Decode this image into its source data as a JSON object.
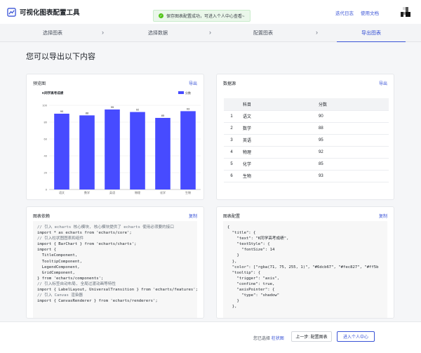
{
  "app": {
    "title": "可视化图表配置工具"
  },
  "toast": {
    "message": "保存图表配置成功，可进入个人中心查看~"
  },
  "header": {
    "changelog": "迭代日志",
    "docs": "使用文档"
  },
  "steps": [
    {
      "label": "选择图表"
    },
    {
      "label": "选择数据"
    },
    {
      "label": "配置图表"
    },
    {
      "label": "导出图表"
    }
  ],
  "page": {
    "title": "您可以导出以下内容"
  },
  "preview": {
    "title": "预览图",
    "action": "导出"
  },
  "datasource": {
    "title": "数据源",
    "action": "导出",
    "columns": [
      "",
      "科目",
      "分数"
    ],
    "rows": [
      [
        "1",
        "语文",
        "90"
      ],
      [
        "2",
        "数学",
        "88"
      ],
      [
        "3",
        "英语",
        "95"
      ],
      [
        "4",
        "物理",
        "92"
      ],
      [
        "5",
        "化学",
        "85"
      ],
      [
        "6",
        "生物",
        "93"
      ]
    ]
  },
  "deps": {
    "title": "图表依赖",
    "action": "复制",
    "lines": [
      "// 引入 echarts 核心模块, 核心模块提供了 echarts 使用必须要的接口",
      "import * as echarts from 'echarts/core';",
      "// 引入柱状图图表和组件",
      "import { BarChart } from 'echarts/charts';",
      "import {",
      "  TitleComponent,",
      "  TooltipComponent,",
      "  LegendComponent,",
      "  GridComponent,",
      "} from 'echarts/components';",
      "// 引入标签自动布局, 全局过渡动画等特性",
      "import { LabelLayout, UniversalTransition } from 'echarts/features';",
      "// 引入 Canvas 渲染器",
      "import { CanvasRenderer } from 'echarts/renderers';"
    ]
  },
  "config": {
    "title": "图表配置",
    "action": "复制",
    "lines": [
      "{",
      "  \"title\": {",
      "    \"text\": \"K同学高考成绩\",",
      "    \"textStyle\": {",
      "      \"fontSize\": 14",
      "    }",
      "  },",
      "  \"color\": [\"rgba(71, 75, 255, 1)\", \"#6dcb67\", \"#fec827\", \"#ff5b",
      "  \"tooltip\": {",
      "    \"trigger\": \"axis\",",
      "    \"confine\": true,",
      "    \"axisPointer\": {",
      "      \"type\": \"shadow\"",
      "    }",
      "  },"
    ]
  },
  "footer": {
    "prefix": "您已选择",
    "selected": "柱状图",
    "prev": "上一步: 配置图表",
    "next": "进入个人中心"
  },
  "chart_data": {
    "type": "bar",
    "title": "K同学高考成绩",
    "categories": [
      "语文",
      "数学",
      "英语",
      "物理",
      "化学",
      "生物"
    ],
    "series": [
      {
        "name": "分数",
        "values": [
          90,
          88,
          95,
          92,
          85,
          93
        ]
      }
    ],
    "ylim": [
      0,
      100
    ],
    "yticks": [
      0,
      20,
      40,
      60,
      80,
      100
    ],
    "color": "#474bff",
    "legend": "top-right",
    "grid": true
  }
}
